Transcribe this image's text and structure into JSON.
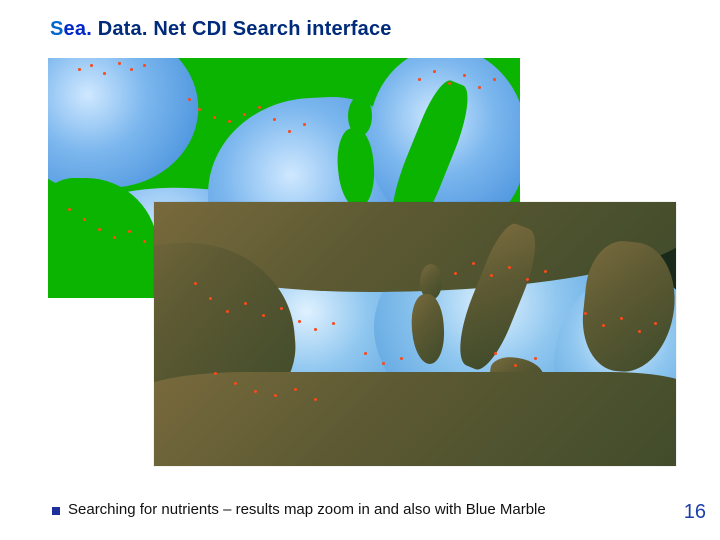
{
  "title": {
    "s": "S",
    "ea": "ea. ",
    "rest": "Data. Net CDI Search interface"
  },
  "caption": "Searching for nutrients – results map zoom in and also with Blue Marble",
  "page_number": "16",
  "maps": {
    "back": {
      "label": "results-map-green-basemap"
    },
    "front": {
      "label": "results-map-blue-marble"
    }
  }
}
